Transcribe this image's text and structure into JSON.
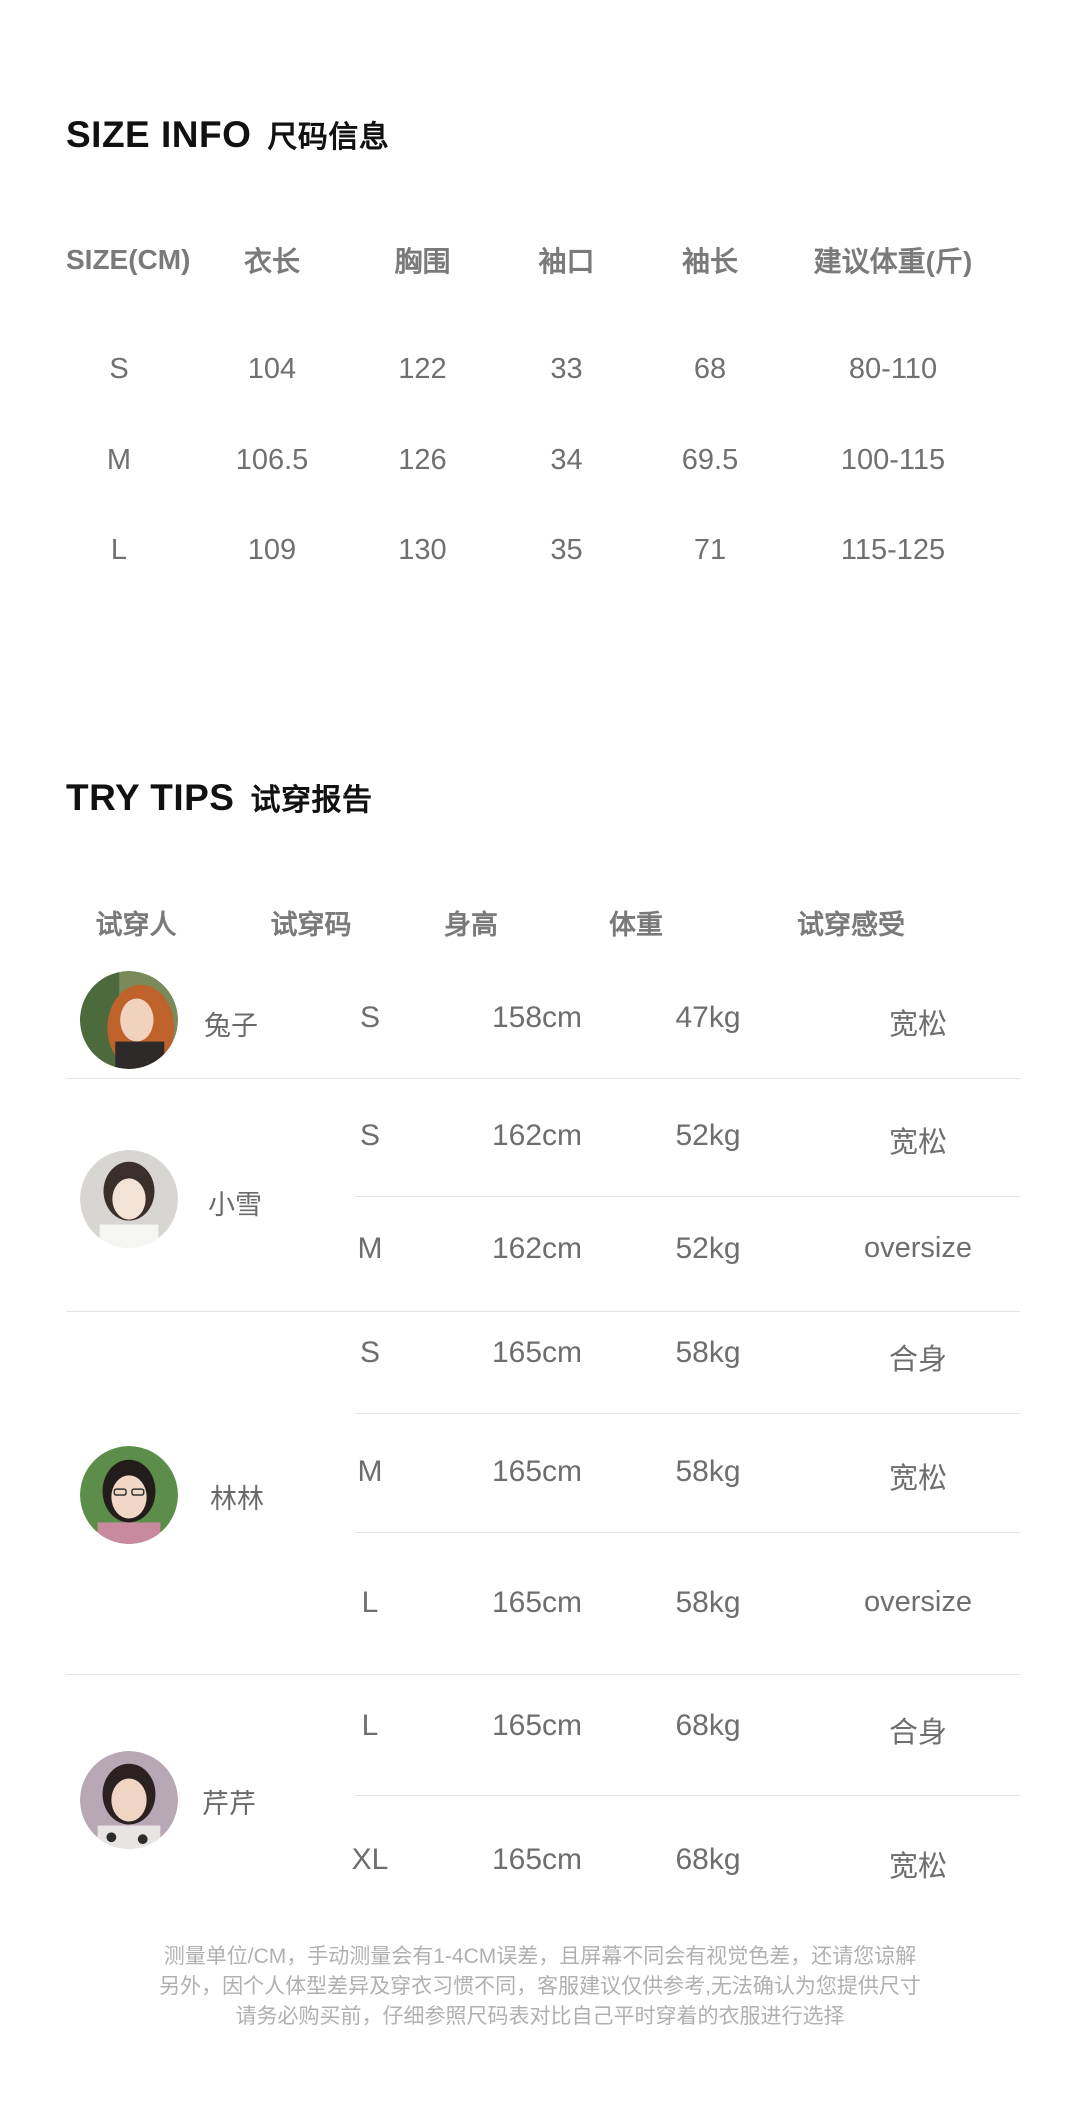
{
  "size_info": {
    "title_en": "SIZE INFO",
    "title_cn": "尺码信息",
    "headers": [
      "SIZE(CM)",
      "衣长",
      "胸围",
      "袖口",
      "袖长",
      "建议体重(斤)"
    ],
    "rows": [
      [
        "S",
        "104",
        "122",
        "33",
        "68",
        "80-110"
      ],
      [
        "M",
        "106.5",
        "126",
        "34",
        "69.5",
        "100-115"
      ],
      [
        "L",
        "109",
        "130",
        "35",
        "71",
        "115-125"
      ]
    ]
  },
  "try_tips": {
    "title_en": "TRY TIPS",
    "title_cn": "试穿报告",
    "headers": [
      "试穿人",
      "试穿码",
      "身高",
      "体重",
      "试穿感受"
    ],
    "testers": [
      {
        "name": "兔子",
        "rows": [
          [
            "S",
            "158cm",
            "47kg",
            "宽松"
          ]
        ]
      },
      {
        "name": "小雪",
        "rows": [
          [
            "S",
            "162cm",
            "52kg",
            "宽松"
          ],
          [
            "M",
            "162cm",
            "52kg",
            "oversize"
          ]
        ]
      },
      {
        "name": "林林",
        "rows": [
          [
            "S",
            "165cm",
            "58kg",
            "合身"
          ],
          [
            "M",
            "165cm",
            "58kg",
            "宽松"
          ],
          [
            "L",
            "165cm",
            "58kg",
            "oversize"
          ]
        ]
      },
      {
        "name": "芹芹",
        "rows": [
          [
            "L",
            "165cm",
            "68kg",
            "合身"
          ],
          [
            "XL",
            "165cm",
            "68kg",
            "宽松"
          ]
        ]
      }
    ]
  },
  "notes": [
    "测量单位/CM，手动测量会有1-4CM误差，且屏幕不同会有视觉色差，还请您谅解",
    "另外，因个人体型差异及穿衣习惯不同，客服建议仅供参考,无法确认为您提供尺寸",
    "请务必购买前，仔细参照尺码表对比自己平时穿着的衣服进行选择"
  ]
}
